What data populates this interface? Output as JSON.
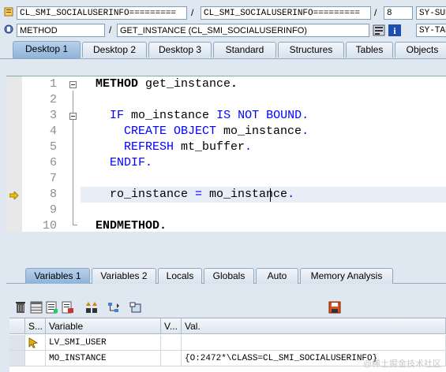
{
  "header": {
    "row1": {
      "field1": "CL_SMI_SOCIALUSERINFO=========",
      "sep1": "/",
      "field2": "CL_SMI_SOCIALUSERINFO=========",
      "sep2": "/",
      "field3": "8",
      "field4": "SY-SUBRC"
    },
    "row2": {
      "field1": "METHOD",
      "sep1": "/",
      "field2": "GET_INSTANCE (CL_SMI_SOCIALUSERINFO)",
      "field4": "SY-TABIX"
    }
  },
  "desktop_tabs": [
    "Desktop 1",
    "Desktop 2",
    "Desktop 3",
    "Standard",
    "Structures",
    "Tables",
    "Objects"
  ],
  "code_lines": [
    {
      "n": "1",
      "parts": [
        [
          "kwb",
          "METHOD "
        ],
        [
          "",
          "get_instance"
        ],
        [
          "kwb",
          "."
        ]
      ]
    },
    {
      "n": "2",
      "parts": []
    },
    {
      "n": "3",
      "parts": [
        [
          "",
          "  "
        ],
        [
          "kw",
          "IF "
        ],
        [
          "",
          "mo_instance "
        ],
        [
          "kw",
          "IS NOT BOUND"
        ],
        [
          "kw",
          "."
        ]
      ]
    },
    {
      "n": "4",
      "parts": [
        [
          "",
          "    "
        ],
        [
          "kw",
          "CREATE OBJECT "
        ],
        [
          "",
          "mo_instance"
        ],
        [
          "kw",
          "."
        ]
      ]
    },
    {
      "n": "5",
      "parts": [
        [
          "",
          "    "
        ],
        [
          "kw",
          "REFRESH "
        ],
        [
          "",
          "mt_buffer"
        ],
        [
          "kw",
          "."
        ]
      ]
    },
    {
      "n": "6",
      "parts": [
        [
          "",
          "  "
        ],
        [
          "kw",
          "ENDIF"
        ],
        [
          "kw",
          "."
        ]
      ]
    },
    {
      "n": "7",
      "parts": []
    },
    {
      "n": "8",
      "parts": [
        [
          "",
          "  ro_instance "
        ],
        [
          "kw",
          "= "
        ],
        [
          "",
          "mo_instance"
        ],
        [
          "kw",
          "."
        ]
      ]
    },
    {
      "n": "9",
      "parts": []
    },
    {
      "n": "10",
      "parts": [
        [
          "kwb",
          "ENDMETHOD"
        ],
        [
          "kwb",
          "."
        ]
      ]
    }
  ],
  "variable_tabs": [
    "Variables 1",
    "Variables 2",
    "Locals",
    "Globals",
    "Auto",
    "Memory Analysis"
  ],
  "grid": {
    "headers": {
      "s": "S...",
      "variable": "Variable",
      "v": "V...",
      "val": "Val."
    },
    "rows": [
      {
        "variable": "LV_SMI_USER",
        "val": ""
      },
      {
        "variable": "MO_INSTANCE",
        "val": "{O:2472*\\CLASS=CL_SMI_SOCIALUSERINFO}"
      }
    ]
  },
  "watermark": "@稀土掘金技术社区",
  "colors": {
    "keyword": "#0000ff",
    "current_line": "#e8eef8",
    "line_number": "#8e8e8e"
  }
}
